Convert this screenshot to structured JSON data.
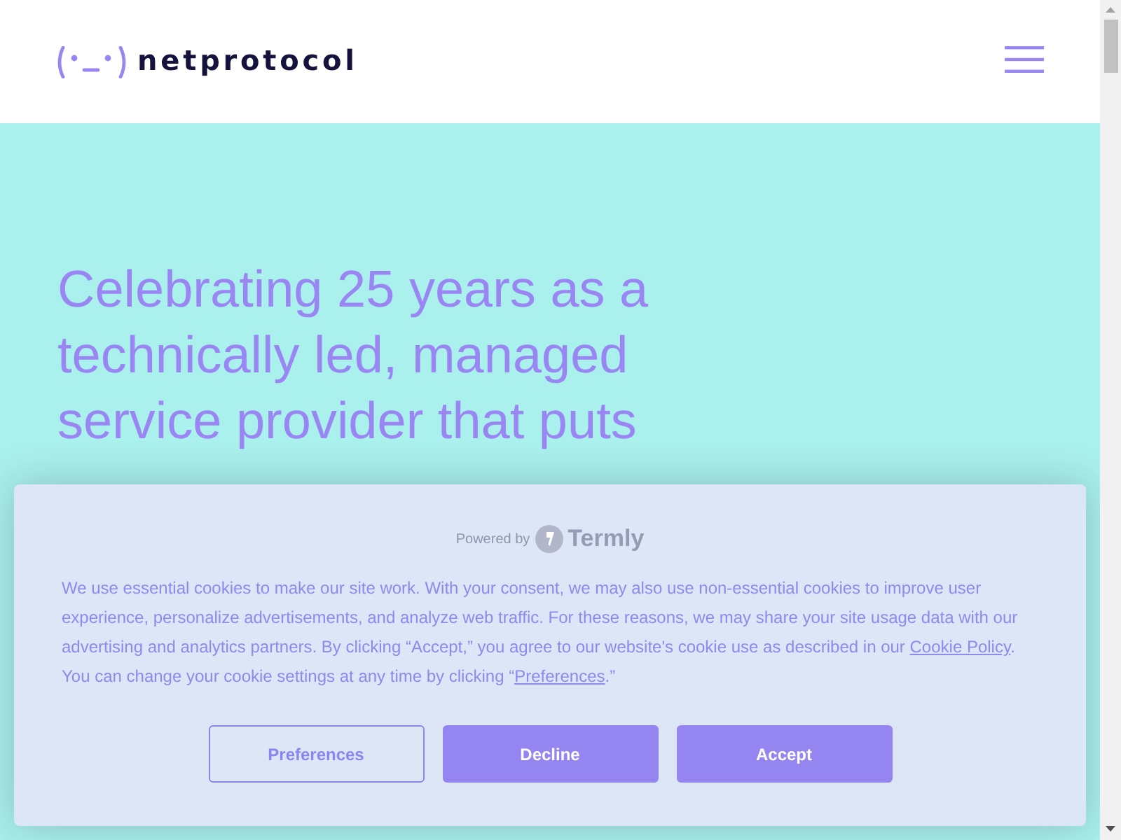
{
  "header": {
    "wordmark": "netprotocol"
  },
  "hero": {
    "heading": "Celebrating 25 years as a technically led, managed service provider that puts"
  },
  "cookie_banner": {
    "powered_by": "Powered by",
    "brand": "Termly",
    "message": [
      {
        "kind": "text",
        "text": "We use essential cookies to make our site work. With your consent, we may also use non-essential cookies to improve user experience, personalize advertisements, and analyze web traffic. For these reasons, we may share your site usage data with our advertising and analytics partners. By clicking “Accept,” you agree to our website's cookie use as described in our "
      },
      {
        "kind": "link",
        "text": "Cookie Policy"
      },
      {
        "kind": "text",
        "text": ". You can change your cookie settings at any time by clicking “"
      },
      {
        "kind": "link",
        "text": "Preferences"
      },
      {
        "kind": "text",
        "text": ".”"
      }
    ],
    "buttons": [
      {
        "label": "Preferences",
        "kind": "outline"
      },
      {
        "label": "Decline",
        "kind": "filled"
      },
      {
        "label": "Accept",
        "kind": "filled"
      }
    ]
  }
}
